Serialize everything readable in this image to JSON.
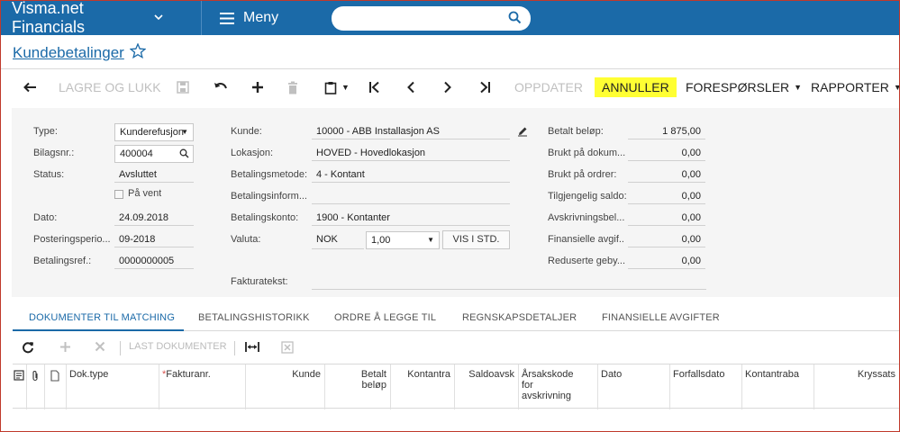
{
  "topbar": {
    "app_name": "Visma.net Financials",
    "menu_label": "Meny",
    "search_placeholder": ""
  },
  "page": {
    "title": "Kundebetalinger"
  },
  "toolbar": {
    "save_close": "LAGRE OG LUKK",
    "update": "OPPDATER",
    "cancel": "ANNULLER",
    "inquiries": "FORESPØRSLER",
    "reports": "RAPPORTER"
  },
  "form": {
    "type_label": "Type:",
    "type_value": "Kunderefusjon",
    "doc_label": "Bilagsnr.:",
    "doc_value": "400004",
    "status_label": "Status:",
    "status_value": "Avsluttet",
    "hold_label": "På vent",
    "date_label": "Dato:",
    "date_value": "24.09.2018",
    "period_label": "Posteringsperio...",
    "period_value": "09-2018",
    "payref_label": "Betalingsref.:",
    "payref_value": "0000000005",
    "customer_label": "Kunde:",
    "customer_value": "10000 - ABB Installasjon AS",
    "location_label": "Lokasjon:",
    "location_value": "HOVED - Hovedlokasjon",
    "method_label": "Betalingsmetode:",
    "method_value": "4 - Kontant",
    "payinfo_label": "Betalingsinform...",
    "payinfo_value": "",
    "account_label": "Betalingskonto:",
    "account_value": "1900 - Kontanter",
    "currency_label": "Valuta:",
    "currency_value": "NOK",
    "rate_value": "1,00",
    "vis_button": "VIS I STD.",
    "invoicetext_label": "Fakturatekst:",
    "invoicetext_value": "",
    "paid_label": "Betalt beløp:",
    "paid_value": "1 875,00",
    "used_docs_label": "Brukt på dokum...",
    "used_docs_value": "0,00",
    "used_orders_label": "Brukt på ordrer:",
    "used_orders_value": "0,00",
    "available_label": "Tilgjengelig saldo:",
    "available_value": "0,00",
    "writeoff_label": "Avskrivningsbel...",
    "writeoff_value": "0,00",
    "fin_fees_label": "Finansielle avgif...",
    "fin_fees_value": "0,00",
    "reduced_fees_label": "Reduserte geby...",
    "reduced_fees_value": "0,00"
  },
  "tabs": [
    {
      "label": "DOKUMENTER TIL MATCHING"
    },
    {
      "label": "BETALINGSHISTORIKK"
    },
    {
      "label": "ORDRE Å LEGGE TIL"
    },
    {
      "label": "REGNSKAPSDETALJER"
    },
    {
      "label": "FINANSIELLE AVGIFTER"
    }
  ],
  "grid_toolbar": {
    "load_docs": "LAST DOKUMENTER"
  },
  "grid": {
    "columns": [
      {
        "label": "Dok.type"
      },
      {
        "label": "Fakturanr."
      },
      {
        "label": "Kunde"
      },
      {
        "label": "Betalt beløp"
      },
      {
        "label": "Kontantra"
      },
      {
        "label": "Saldoavsk"
      },
      {
        "label": "Årsakskode for avskrivning"
      },
      {
        "label": "Dato"
      },
      {
        "label": "Forfallsdato"
      },
      {
        "label": "Kontantraba"
      },
      {
        "label": "Kryssats"
      }
    ]
  },
  "colors": {
    "topbar": "#1b6aa8",
    "accent": "#1b6aa8",
    "highlight": "#ffff33"
  }
}
